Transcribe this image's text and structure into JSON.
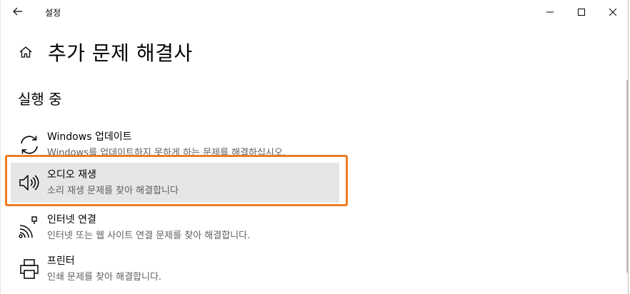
{
  "window": {
    "title": "설정",
    "back_icon": "arrow-left-icon",
    "controls": [
      "minimize-icon",
      "maximize-icon",
      "close-icon"
    ]
  },
  "header": {
    "home_icon": "home-icon",
    "title": "추가 문제 해결사"
  },
  "section": {
    "title": "실행 중"
  },
  "troubleshooters": [
    {
      "name": "Windows 업데이트",
      "description": "Windows를 업데이트하지 못하게 하는 문제를 해결하십시오.",
      "icon": "refresh-icon",
      "selected": false
    },
    {
      "name": "오디오 재생",
      "description": "소리 재생 문제를 찾아 해결합니다",
      "icon": "speaker-icon",
      "selected": true
    },
    {
      "name": "인터넷 연결",
      "description": "인터넷 또는 웹 사이트 연결 문제를 찾아 해결합니다.",
      "icon": "wifi-ethernet-icon",
      "selected": false
    },
    {
      "name": "프린터",
      "description": "인쇄 문제를 찾아 해결합니다.",
      "icon": "printer-icon",
      "selected": false
    }
  ],
  "colors": {
    "highlight_border": "#f07a22",
    "selected_bg": "#e6e6e6",
    "description_text": "#5f5f5f"
  }
}
